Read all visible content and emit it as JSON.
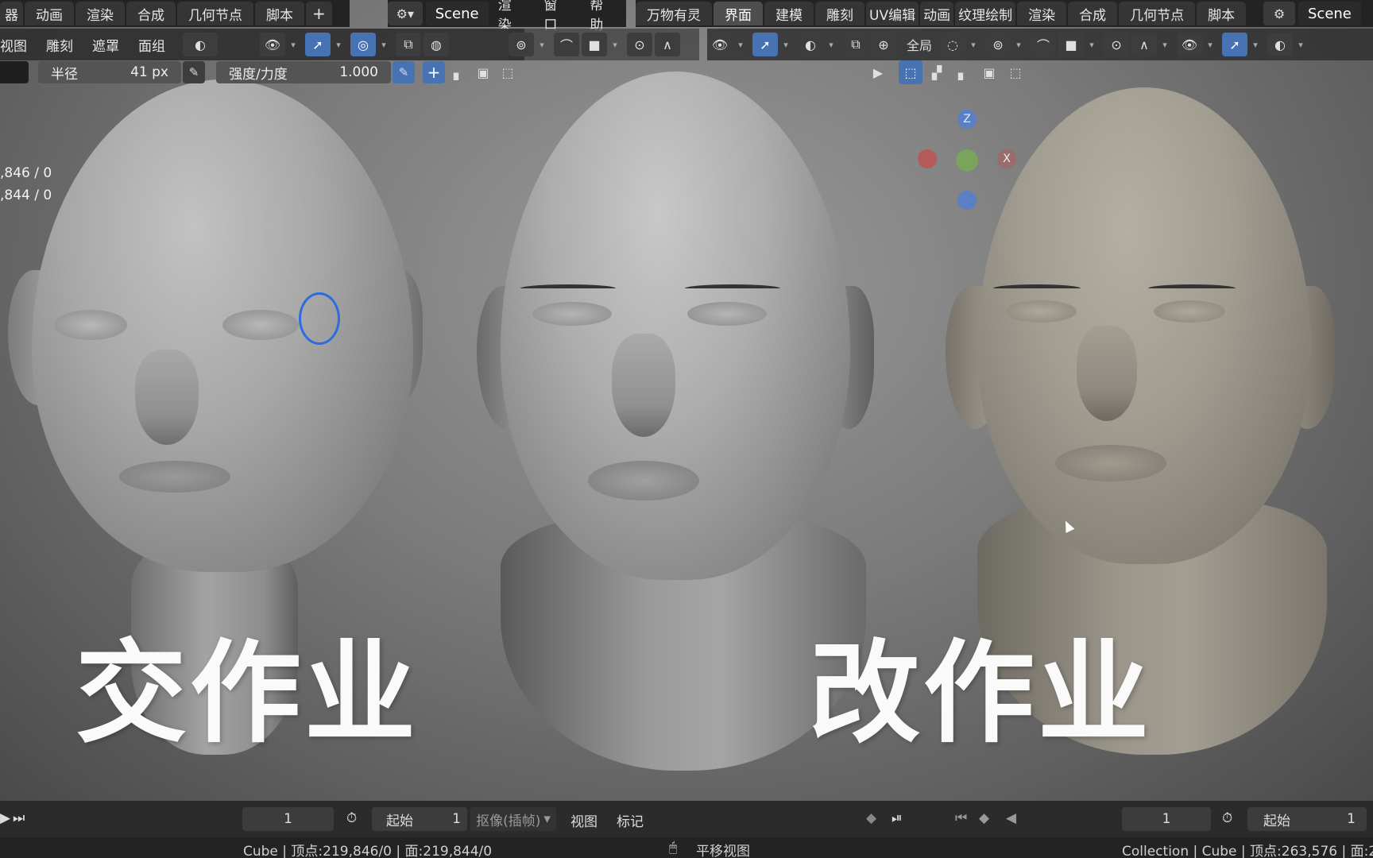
{
  "left_window": {
    "tabs": [
      "器",
      "动画",
      "渲染",
      "合成",
      "几何节点",
      "脚本"
    ],
    "add_tab": "+",
    "header_menus": [
      "视图",
      "雕刻",
      "遮罩",
      "面组"
    ],
    "radius_label": "半径",
    "radius_value": "41 px",
    "strength_label": "强度/力度",
    "strength_value": "1.000",
    "add_icon": "+",
    "stats": [
      ",846 / 0",
      ",844 / 0"
    ]
  },
  "center_window": {
    "scene": "Scene",
    "menus": [
      "渲染",
      "窗口",
      "帮助"
    ]
  },
  "right_window": {
    "tabs": [
      "万物有灵",
      "界面",
      "建模",
      "雕刻",
      "UV编辑",
      "动画",
      "纹理绘制",
      "渲染",
      "合成",
      "几何节点",
      "脚本"
    ],
    "active_tab": "界面",
    "add_tab": "+",
    "scene": "Scene",
    "global_label": "全局",
    "gizmo_z": "Z",
    "gizmo_x": "X"
  },
  "overlay": {
    "left_title": "交作业",
    "right_title": "改作业"
  },
  "timeline": {
    "current_frame_left": "1",
    "start_label_left": "起始",
    "start_value_left": "1",
    "keying": "抠像(插帧)",
    "view": "视图",
    "marker": "标记",
    "current_frame_right": "1",
    "start_label_right": "起始",
    "start_value_right": "1"
  },
  "statusbar": {
    "left": "Cube | 顶点:219,846/0 | 面:219,844/0",
    "center": "平移视图",
    "right": "Collection | Cube | 顶点:263,576 | 面:2"
  },
  "colors": {
    "accent_blue": "#4772b3",
    "brush_ring": "#2d6be0",
    "head_grey": "#a9a9a9",
    "head_clay": "#9b968a"
  }
}
